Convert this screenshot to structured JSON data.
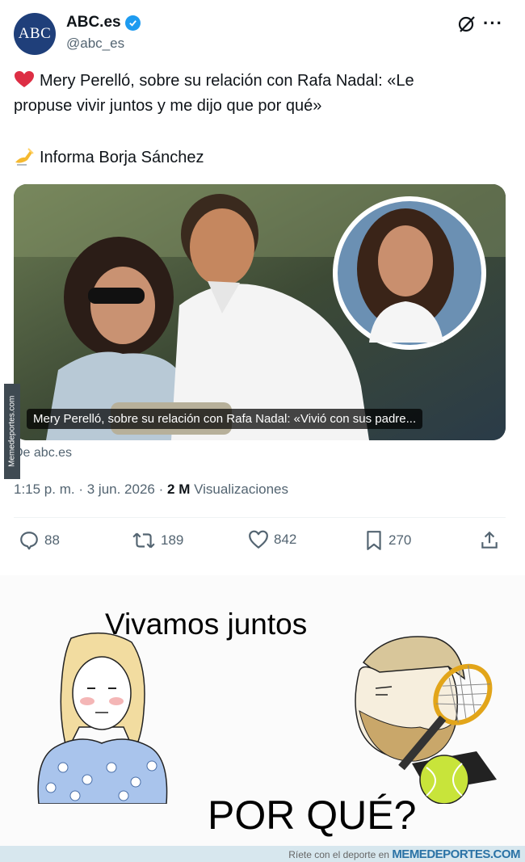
{
  "tweet": {
    "avatar_text": "ABC",
    "display_name": "ABC.es",
    "handle": "@abc_es",
    "line1": "Mery Perelló, sobre su relación con Rafa Nadal: «Le",
    "line2": "propuse vivir juntos y me dijo que por qué»",
    "line3": "Informa Borja Sánchez",
    "card_caption": "Mery Perelló, sobre su relación con Rafa Nadal: «Vivió con sus padre...",
    "card_source": "De abc.es",
    "time": "1:15 p. m.",
    "date": "3 jun. 2026",
    "views_count": "2 M",
    "views_label": "Visualizaciones",
    "replies": "88",
    "retweets": "189",
    "likes": "842",
    "bookmarks": "270",
    "side_watermark": "Memedeportes.com"
  },
  "meme": {
    "top_text": "Vivamos juntos",
    "bottom_text": "POR QUÉ?"
  },
  "footer": {
    "prefix": "Ríete con el deporte en",
    "brand": "MEMEDEPORTES.COM"
  },
  "colors": {
    "brand_blue": "#1f3f7a",
    "verified": "#1d9bf0",
    "muted": "#536471"
  }
}
